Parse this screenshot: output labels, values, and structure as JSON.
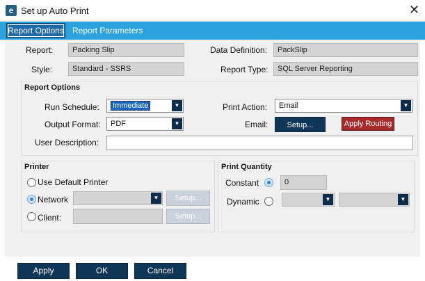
{
  "window": {
    "title": "Set up Auto Print",
    "app_icon": "e"
  },
  "tabs": [
    {
      "label": "Report Options",
      "active": true
    },
    {
      "label": "Report Parameters",
      "active": false
    }
  ],
  "header": {
    "report_label": "Report:",
    "report_value": "Packing Slip",
    "data_def_label": "Data Definition:",
    "data_def_value": "PackSlip",
    "style_label": "Style:",
    "style_value": "Standard - SSRS",
    "report_type_label": "Report Type:",
    "report_type_value": "SQL Server Reporting"
  },
  "report_options": {
    "title": "Report Options",
    "run_schedule_label": "Run Schedule:",
    "run_schedule_value": "Immediate",
    "print_action_label": "Print Action:",
    "print_action_value": "Email",
    "output_format_label": "Output Format:",
    "output_format_value": "PDF",
    "email_label": "Email:",
    "setup_label": "Setup...",
    "apply_routing_label": "Apply Routing",
    "user_description_label": "User Description:",
    "user_description_value": ""
  },
  "printer": {
    "title": "Printer",
    "use_default_label": "Use Default Printer",
    "network_label": "Network",
    "client_label": "Client:",
    "network_setup_label": "Setup...",
    "client_setup_label": "Setup...",
    "selected": "network"
  },
  "print_quantity": {
    "title": "Print Quantity",
    "constant_label": "Constant",
    "constant_value": "0",
    "dynamic_label": "Dynamic",
    "selected": "constant"
  },
  "footer": {
    "apply_label": "Apply",
    "ok_label": "OK",
    "cancel_label": "Cancel"
  },
  "colors": {
    "accent": "#2aa0dc",
    "button_dark": "#0f3657",
    "routing_red": "#a82a2a"
  }
}
